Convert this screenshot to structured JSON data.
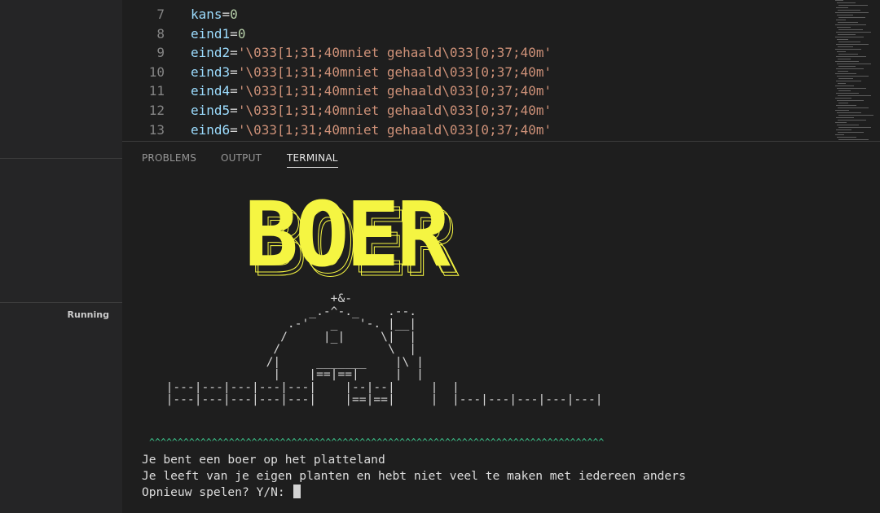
{
  "sidebar": {
    "status_label": "Running"
  },
  "editor": {
    "lines": [
      {
        "n": "7",
        "var": "kans",
        "op": "=",
        "val": "0",
        "kind": "num"
      },
      {
        "n": "8",
        "var": "eind1",
        "op": "=",
        "val": "0",
        "kind": "num"
      },
      {
        "n": "9",
        "var": "eind2",
        "op": "=",
        "val": "'\\033[1;31;40mniet gehaald\\033[0;37;40m'",
        "kind": "str"
      },
      {
        "n": "10",
        "var": "eind3",
        "op": "=",
        "val": "'\\033[1;31;40mniet gehaald\\033[0;37;40m'",
        "kind": "str"
      },
      {
        "n": "11",
        "var": "eind4",
        "op": "=",
        "val": "'\\033[1;31;40mniet gehaald\\033[0;37;40m'",
        "kind": "str"
      },
      {
        "n": "12",
        "var": "eind5",
        "op": "=",
        "val": "'\\033[1;31;40mniet gehaald\\033[0;37;40m'",
        "kind": "str"
      },
      {
        "n": "13",
        "var": "eind6",
        "op": "=",
        "val": "'\\033[1;31;40mniet gehaald\\033[0;37;40m'",
        "kind": "str"
      }
    ]
  },
  "panel": {
    "tabs": [
      {
        "label": "PROBLEMS",
        "active": false
      },
      {
        "label": "OUTPUT",
        "active": false
      },
      {
        "label": "TERMINAL",
        "active": true
      }
    ]
  },
  "terminal": {
    "title_text": "BOER",
    "title_color": "#f5f542",
    "farm_art": "                         +&-\n                      _.-^-._    .--.\n                   .-'   _   '-. |__|\n                  /     |_|     \\|  |\n                 /               \\  |\n                /|     _______    |\\ |\n                 |    |==|==|     |  |\n  |---|---|---|---|---|    |--|--|     |  |\n  |---|---|---|---|---|    |==|==|     |  |---|---|---|---|---|",
    "grass": "^^^^^^^^^^^^^^^^^^^^^^^^^^^^^^^^^^^^^^^^^^^^^^^^^^^^^^^^^^^^^^^^^^^^^^^^^^^^^^^^^^^^^^^^^^^^^^^^^^^^^^^^^^^^^^^^^^^^^^^^^",
    "grass_color": "#3dc98f",
    "line1": "Je bent een boer op het platteland",
    "line2": "Je leeft van je eigen planten en hebt niet veel te maken met iedereen anders",
    "prompt": "Opnieuw spelen? Y/N: "
  },
  "colors": {
    "background": "#1e1e1e",
    "sidebar": "#252526",
    "line_number": "#858585",
    "variable": "#9cdcfe",
    "number": "#b5cea8",
    "string": "#ce9178"
  }
}
